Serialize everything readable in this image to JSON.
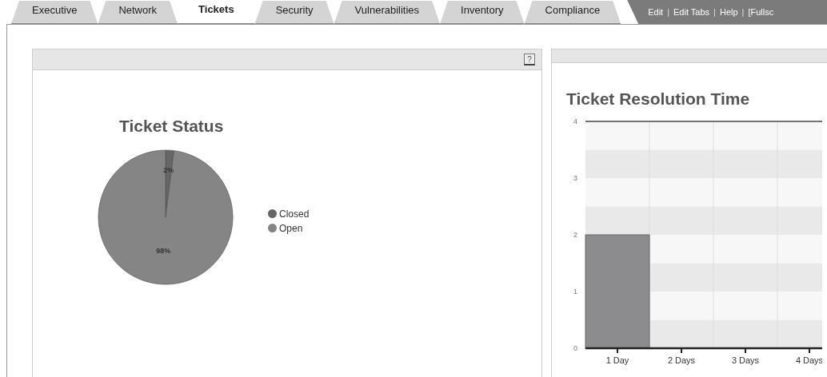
{
  "tabs": [
    {
      "label": "Executive",
      "selected": false
    },
    {
      "label": "Network",
      "selected": false
    },
    {
      "label": "Tickets",
      "selected": true
    },
    {
      "label": "Security",
      "selected": false
    },
    {
      "label": "Vulnerabilities",
      "selected": false
    },
    {
      "label": "Inventory",
      "selected": false
    },
    {
      "label": "Compliance",
      "selected": false
    }
  ],
  "top_links": [
    {
      "kind": "link",
      "text": "Edit"
    },
    {
      "kind": "separator",
      "text": "|"
    },
    {
      "kind": "link",
      "text": "Edit Tabs"
    },
    {
      "kind": "separator",
      "text": "|"
    },
    {
      "kind": "link",
      "text": "Help"
    },
    {
      "kind": "separator",
      "text": "|"
    },
    {
      "kind": "link",
      "text": "[Fullsc"
    }
  ],
  "panels": [
    {
      "help_icon": "?",
      "chart_data": {
        "type": "pie",
        "title": "Ticket Status",
        "categories": [
          "Closed",
          "Open"
        ],
        "values": [
          2,
          98
        ],
        "colors": [
          "#666666",
          "#858585"
        ],
        "data_labels": true,
        "value_labels": [
          "2%",
          "98%"
        ]
      }
    },
    {
      "chart_data": {
        "type": "bar",
        "title": "Ticket Resolution Time",
        "categories": [
          "1 Day",
          "2 Days",
          "3 Days",
          "4 Days"
        ],
        "values": [
          2,
          0,
          0,
          0
        ],
        "ylim": [
          0,
          4
        ],
        "yticks": [
          0,
          1,
          2,
          3,
          4
        ]
      }
    }
  ]
}
